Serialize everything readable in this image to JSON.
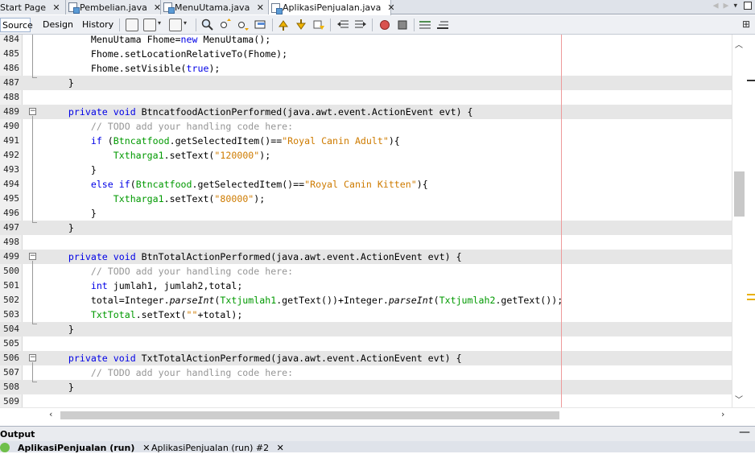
{
  "tabs": [
    {
      "label": "Start Page",
      "active": false
    },
    {
      "label": "Pembelian.java",
      "active": false
    },
    {
      "label": "MenuUtama.java",
      "active": false
    },
    {
      "label": "AplikasiPenjualan.java",
      "active": true
    }
  ],
  "toolbar": {
    "source_label": "Source",
    "design_label": "Design",
    "history_label": "History"
  },
  "editor": {
    "lines": [
      {
        "n": "484",
        "hl": false,
        "html": "        MenuUtama Fhome=<span class=kw>new</span> MenuUtama();"
      },
      {
        "n": "485",
        "hl": false,
        "html": "        Fhome.setLocationRelativeTo(Fhome);"
      },
      {
        "n": "486",
        "hl": false,
        "html": "        Fhome.setVisible(<span class=kw>true</span>);"
      },
      {
        "n": "487",
        "hl": true,
        "html": "    }"
      },
      {
        "n": "488",
        "hl": false,
        "html": ""
      },
      {
        "n": "489",
        "hl": true,
        "html": "    <span class=kw>private</span> <span class=kw>void</span> BtncatfoodActionPerformed(java.awt.event.ActionEvent evt) {"
      },
      {
        "n": "490",
        "hl": false,
        "html": "        <span class=cm>// TODO add your handling code here:</span>"
      },
      {
        "n": "491",
        "hl": false,
        "html": "        <span class=kw>if</span> (<span class=fd>Btncatfood</span>.getSelectedItem()==<span class=st>\"Royal Canin Adult\"</span>){"
      },
      {
        "n": "492",
        "hl": false,
        "html": "            <span class=fd>Txtharga1</span>.setText(<span class=st>\"120000\"</span>);"
      },
      {
        "n": "493",
        "hl": false,
        "html": "        }"
      },
      {
        "n": "494",
        "hl": false,
        "html": "        <span class=kw>else</span> <span class=kw>if</span>(<span class=fd>Btncatfood</span>.getSelectedItem()==<span class=st>\"Royal Canin Kitten\"</span>){"
      },
      {
        "n": "495",
        "hl": false,
        "html": "            <span class=fd>Txtharga1</span>.setText(<span class=st>\"80000\"</span>);"
      },
      {
        "n": "496",
        "hl": false,
        "html": "        }"
      },
      {
        "n": "497",
        "hl": true,
        "html": "    }"
      },
      {
        "n": "498",
        "hl": false,
        "html": ""
      },
      {
        "n": "499",
        "hl": true,
        "html": "    <span class=kw>private</span> <span class=kw>void</span> BtnTotalActionPerformed(java.awt.event.ActionEvent evt) {"
      },
      {
        "n": "500",
        "hl": false,
        "html": "        <span class=cm>// TODO add your handling code here:</span>"
      },
      {
        "n": "501",
        "hl": false,
        "html": "        <span class=kw>int</span> jumlah1, jumlah2,total;"
      },
      {
        "n": "502",
        "hl": false,
        "html": "        total=Integer.<span class=it>parseInt</span>(<span class=fd>Txtjumlah1</span>.getText())+Integer.<span class=it>parseInt</span>(<span class=fd>Txtjumlah2</span>.getText());"
      },
      {
        "n": "503",
        "hl": false,
        "html": "        <span class=fd>TxtTotal</span>.setText(<span class=st>\"\"</span>+total);"
      },
      {
        "n": "504",
        "hl": true,
        "html": "    }"
      },
      {
        "n": "505",
        "hl": false,
        "html": ""
      },
      {
        "n": "506",
        "hl": true,
        "html": "    <span class=kw>private</span> <span class=kw>void</span> TxtTotalActionPerformed(java.awt.event.ActionEvent evt) {"
      },
      {
        "n": "507",
        "hl": false,
        "html": "        <span class=cm>// TODO add your handling code here:</span>"
      },
      {
        "n": "508",
        "hl": true,
        "html": "    }"
      },
      {
        "n": "509",
        "hl": false,
        "html": ""
      }
    ]
  },
  "output": {
    "title": "Output",
    "tabs": [
      {
        "label": "AplikasiPenjualan (run)"
      },
      {
        "label": "AplikasiPenjualan (run) #2"
      }
    ]
  }
}
